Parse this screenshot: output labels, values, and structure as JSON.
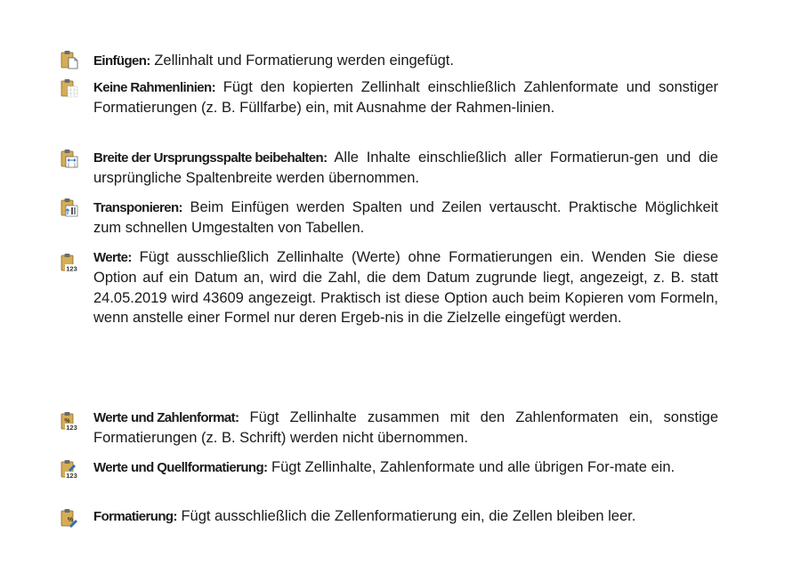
{
  "entries": [
    {
      "icon": "paste-icon",
      "term": "Einfügen:",
      "text": " Zellinhalt und Formatierung werden eingefügt."
    },
    {
      "icon": "paste-no-borders-icon",
      "term": "Keine Rahmenlinien:",
      "text": " Fügt den kopierten Zellinhalt einschließlich Zahlenformate und sonstiger Formatierungen (z. B. Füllfarbe) ein, mit Ausnahme der Rahmen-linien."
    },
    {
      "icon": "paste-keep-column-width-icon",
      "term": "Breite der Ursprungsspalte beibehalten:",
      "text": " Alle Inhalte einschließlich aller Formatierun-gen und die ursprüngliche Spaltenbreite werden übernommen."
    },
    {
      "icon": "paste-transpose-icon",
      "term": "Transponieren:",
      "text": " Beim Einfügen werden Spalten und Zeilen vertauscht. Praktische Möglichkeit zum schnellen Umgestalten von Tabellen."
    },
    {
      "icon": "paste-values-icon",
      "term": "Werte:",
      "text": " Fügt ausschließlich Zellinhalte (Werte) ohne Formatierungen ein. Wenden Sie diese Option auf ein Datum an, wird die Zahl, die dem Datum zugrunde liegt, angezeigt, z. B. statt 24.05.2019  wird 43609 angezeigt. Praktisch ist diese Option auch beim Kopieren vom Formeln, wenn anstelle einer Formel nur deren Ergeb-nis in die Zielzelle eingefügt werden."
    },
    {
      "icon": "paste-values-number-format-icon",
      "term": "Werte und Zahlenformat:",
      "text": " Fügt Zellinhalte zusammen mit den Zahlenformaten ein, sonstige Formatierungen (z. B. Schrift) werden nicht übernommen."
    },
    {
      "icon": "paste-values-source-formatting-icon",
      "term": "Werte und Quellformatierung:",
      "text": " Fügt Zellinhalte, Zahlenformate und alle übrigen For-mate ein."
    },
    {
      "icon": "paste-formatting-icon",
      "term": "Formatierung:",
      "text": " Fügt ausschließlich die Zellenformatierung ein, die Zellen bleiben leer."
    }
  ],
  "icon_labels": {
    "values": "123",
    "percent": "%"
  },
  "colors": {
    "clipboard": "#c9a04a",
    "clipboard_dark": "#8a6a2a",
    "clip": "#6b6b6b",
    "accent_blue": "#2e6fb5",
    "text": "#1a1a1a"
  }
}
